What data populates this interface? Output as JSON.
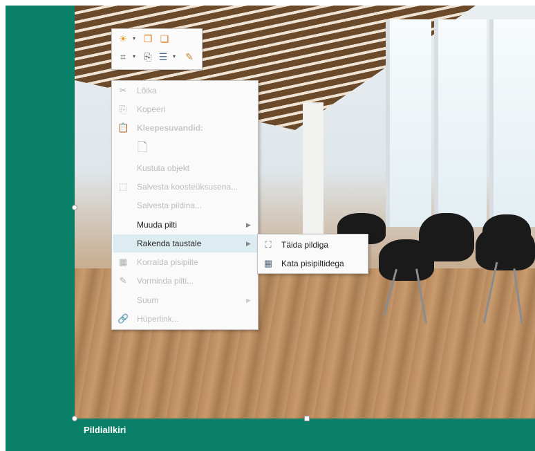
{
  "caption": {
    "text": "Pildiallkiri"
  },
  "mini_toolbar": {
    "icons": [
      "brightness-icon",
      "bring-forward-icon",
      "send-backward-icon",
      "crop-icon",
      "change-picture-icon",
      "text-wrap-icon",
      "format-painter-icon"
    ]
  },
  "context_menu": {
    "items": [
      {
        "label": "Lõika",
        "icon": "scissors-icon"
      },
      {
        "label": "Kopeeri",
        "icon": "copy-icon"
      },
      {
        "label": "Kleepesuvandid:",
        "icon": "paste-icon"
      },
      {
        "label": "",
        "icon": "paste-picture-icon"
      },
      {
        "label": "Kustuta objekt",
        "icon": ""
      },
      {
        "label": "Salvesta koosteüksusena...",
        "icon": "save-block-icon"
      },
      {
        "label": "Salvesta pildina...",
        "icon": ""
      },
      {
        "label": "Muuda pilti",
        "icon": ""
      },
      {
        "label": "Rakenda taustale",
        "icon": ""
      },
      {
        "label": "Korralda pisipilte",
        "icon": "arrange-thumbnails-icon"
      },
      {
        "label": "Vorminda pilti...",
        "icon": "format-picture-icon"
      },
      {
        "label": "Suum",
        "icon": ""
      },
      {
        "label": "Hüperlink...",
        "icon": "hyperlink-icon"
      }
    ]
  },
  "submenu": {
    "items": [
      {
        "label": "Täida pildiga",
        "icon": "fill-picture-icon"
      },
      {
        "label": "Kata pisipiltidega",
        "icon": "tile-thumbnails-icon"
      }
    ]
  },
  "colors": {
    "slide_background": "#0b8068",
    "menu_hover": "#dcecf1"
  }
}
